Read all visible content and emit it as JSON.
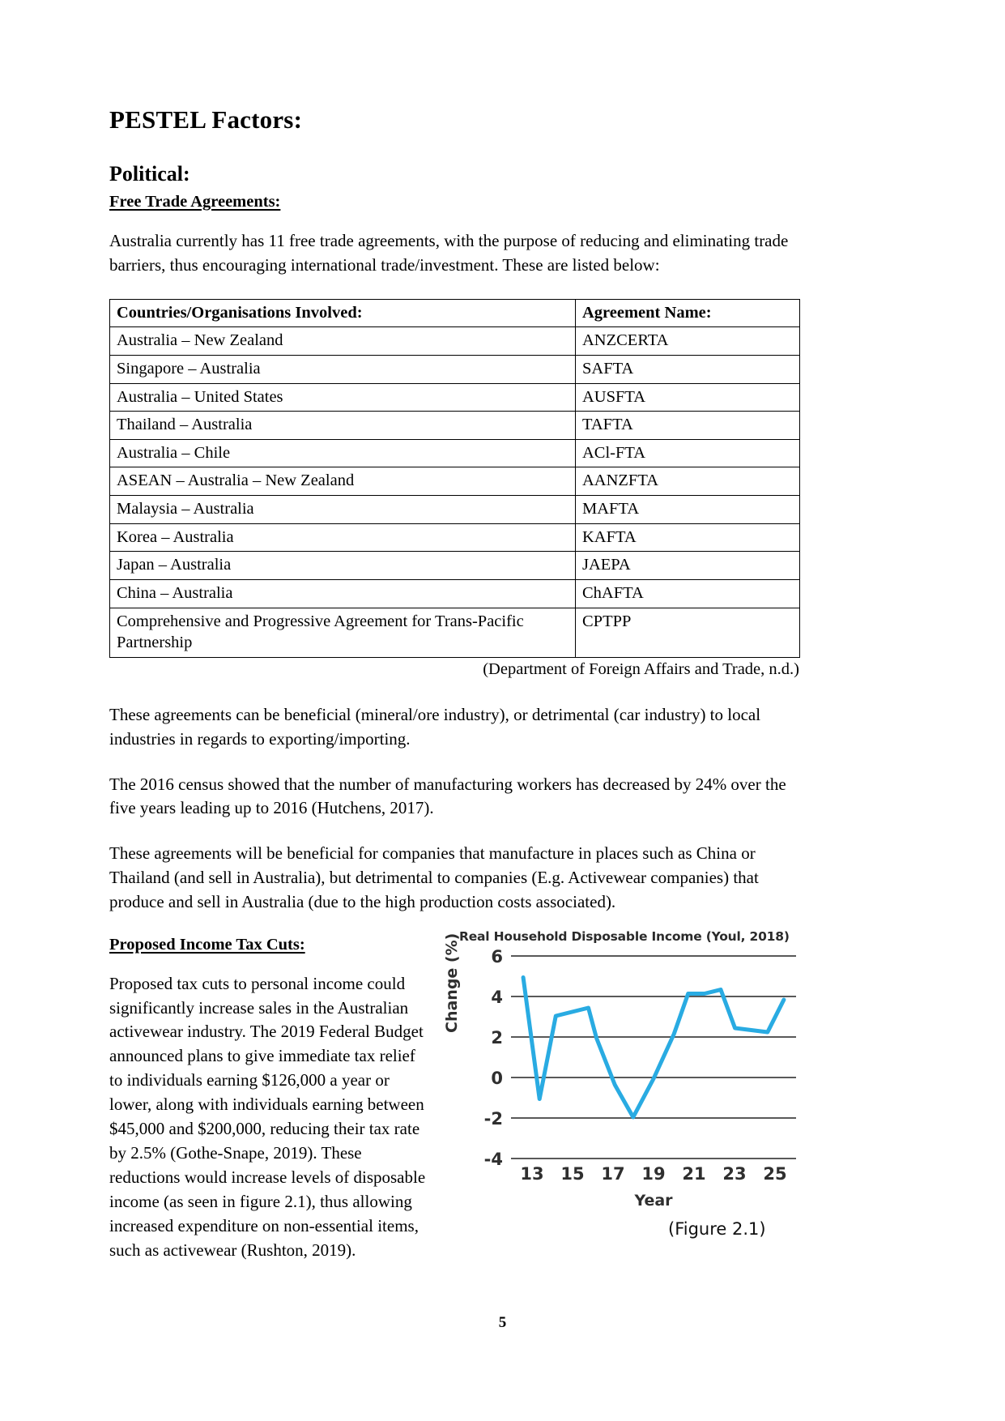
{
  "document": {
    "title": "PESTEL Factors:",
    "page_number": "5"
  },
  "political": {
    "heading": "Political:",
    "fta_subheading": "Free Trade Agreements:",
    "intro_paragraph": "Australia currently has 11 free trade agreements, with the purpose of reducing and eliminating trade barriers, thus encouraging international trade/investment. These are listed below:",
    "table": {
      "headers": [
        "Countries/Organisations Involved:",
        "Agreement Name:"
      ],
      "rows": [
        [
          "Australia – New Zealand",
          "ANZCERTA"
        ],
        [
          "Singapore – Australia",
          "SAFTA"
        ],
        [
          "Australia – United States",
          "AUSFTA"
        ],
        [
          "Thailand – Australia",
          "TAFTA"
        ],
        [
          "Australia – Chile",
          "ACl-FTA"
        ],
        [
          "ASEAN – Australia – New Zealand",
          "AANZFTA"
        ],
        [
          "Malaysia – Australia",
          "MAFTA"
        ],
        [
          "Korea – Australia",
          "KAFTA"
        ],
        [
          "Japan – Australia",
          "JAEPA"
        ],
        [
          "China – Australia",
          "ChAFTA"
        ],
        [
          "Comprehensive and Progressive Agreement for Trans-Pacific Partnership",
          "CPTPP"
        ]
      ]
    },
    "table_citation": "(Department of Foreign Affairs and Trade, n.d.)",
    "paragraph_1": "These agreements can be beneficial (mineral/ore industry), or detrimental (car industry) to local industries in regards to exporting/importing.",
    "paragraph_2": "The 2016 census showed that the number of manufacturing workers has decreased by 24% over the five years leading up to 2016 (Hutchens, 2017).",
    "paragraph_3": "These agreements will be beneficial for companies that manufacture in places such as China or Thailand (and sell in Australia), but detrimental to companies (E.g. Activewear companies) that produce and sell in Australia (due to the high production costs associated).",
    "tax_subheading": "Proposed Income Tax Cuts:",
    "tax_paragraph": "Proposed tax cuts to personal income could significantly increase sales in the Australian activewear industry. The 2019 Federal Budget announced plans to give immediate tax relief to individuals earning $126,000 a year or lower, along with individuals earning between $45,000 and $200,000, reducing their tax rate by 2.5% (Gothe-Snape, 2019). These reductions would increase levels of disposable income (as seen in figure 2.1), thus allowing increased expenditure on non-essential items, such as activewear (Rushton, 2019)."
  },
  "figure": {
    "caption": "(Figure 2.1)",
    "line_color": "#29ABE2"
  },
  "chart_data": {
    "type": "line",
    "title": "Real Household Disposable Income (Youl, 2018)",
    "xlabel": "Year",
    "ylabel": "Change (%)",
    "xlim": [
      12,
      26
    ],
    "ylim": [
      -4,
      6
    ],
    "ytick_labels": [
      "6",
      "4",
      "2",
      "0",
      "-2",
      "-4"
    ],
    "ytick_values": [
      6,
      4,
      2,
      0,
      -2,
      -4
    ],
    "xtick_labels": [
      "13",
      "15",
      "17",
      "19",
      "21",
      "23",
      "25"
    ],
    "xtick_values": [
      13,
      15,
      17,
      19,
      21,
      23,
      25
    ],
    "grid": true,
    "legend": "none",
    "series": [
      {
        "name": "Real Household Disposable Income",
        "x": [
          12.6,
          13.4,
          14.2,
          15.0,
          15.8,
          16.2,
          17.1,
          18.0,
          19.0,
          20.0,
          20.7,
          21.5,
          22.3,
          23.0,
          23.8,
          24.6,
          25.4
        ],
        "values": [
          4.9,
          -1.1,
          3.0,
          3.2,
          3.4,
          1.9,
          -0.4,
          -2.0,
          -0.1,
          2.1,
          4.1,
          4.1,
          4.3,
          2.4,
          2.3,
          2.2,
          3.8
        ]
      }
    ]
  }
}
